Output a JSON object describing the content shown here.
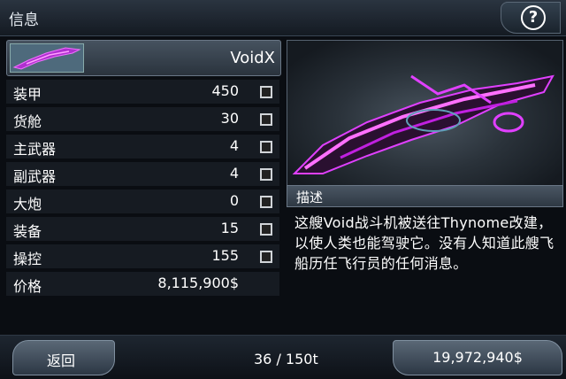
{
  "header": {
    "title": "信息",
    "help_icon": "?"
  },
  "ship": {
    "name": "VoidX"
  },
  "stats": [
    {
      "label": "装甲",
      "value": "450",
      "checkbox": true
    },
    {
      "label": "货舱",
      "value": "30",
      "checkbox": true
    },
    {
      "label": "主武器",
      "value": "4",
      "checkbox": true
    },
    {
      "label": "副武器",
      "value": "4",
      "checkbox": true
    },
    {
      "label": "大炮",
      "value": "0",
      "checkbox": true
    },
    {
      "label": "装备",
      "value": "15",
      "checkbox": true
    },
    {
      "label": "操控",
      "value": "155",
      "checkbox": true
    },
    {
      "label": "价格",
      "value": "8,115,900$",
      "checkbox": false
    }
  ],
  "description": {
    "header": "描述",
    "text": "这艘Void战斗机被送往Thynome改建，以使人类也能驾驶它。没有人知道此艘飞船历任飞行员的任何消息。"
  },
  "footer": {
    "back_label": "返回",
    "cargo": "36 / 150t",
    "money": "19,972,940$"
  },
  "colors": {
    "ship_magenta": "#e040ff",
    "ship_dark": "#1a1024"
  }
}
